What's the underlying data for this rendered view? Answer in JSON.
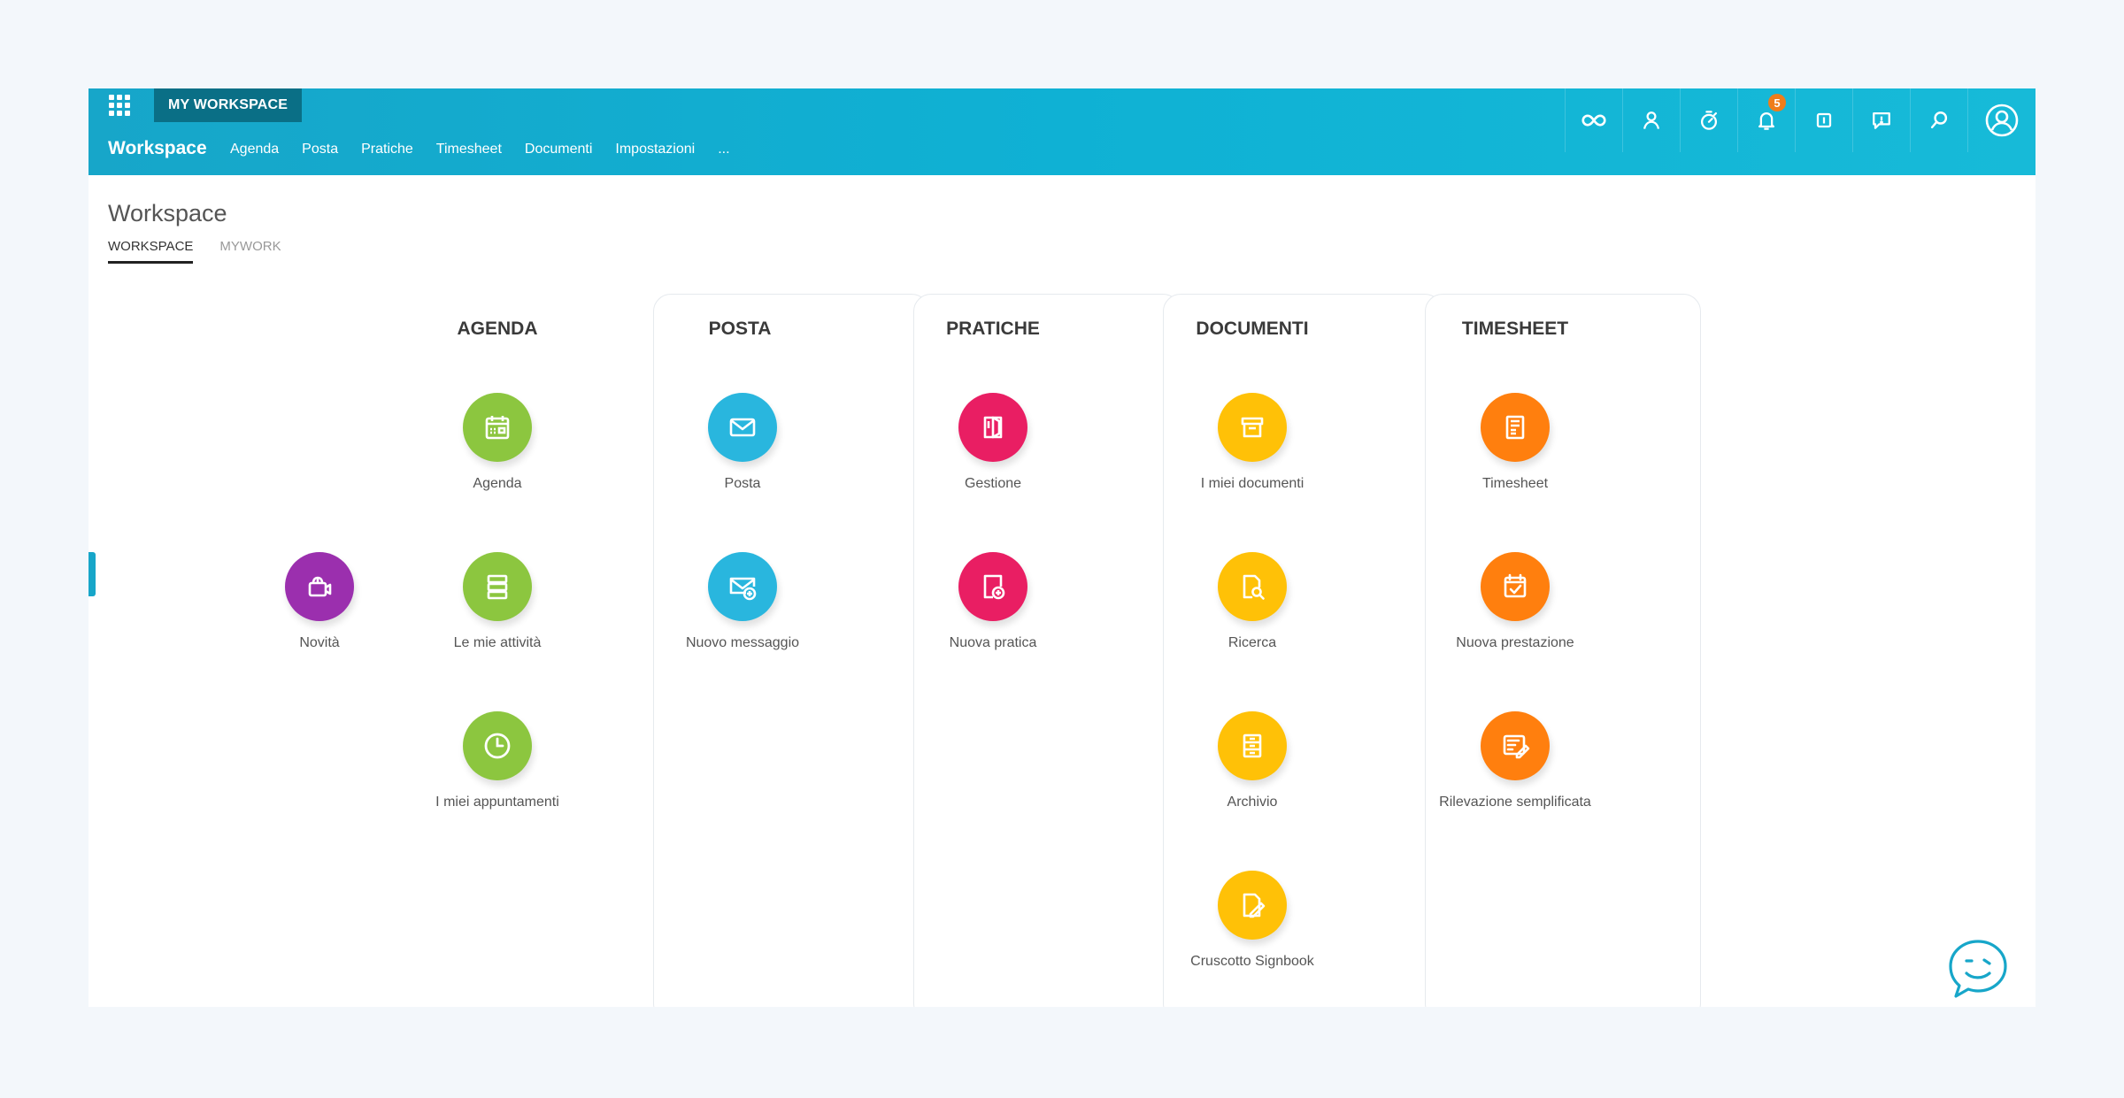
{
  "topbar": {
    "workspace_pill": "MY WORKSPACE",
    "brand": "Workspace",
    "menu": [
      "Agenda",
      "Posta",
      "Pratiche",
      "Timesheet",
      "Documenti",
      "Impostazioni",
      "..."
    ],
    "notifications_count": "5",
    "tools": [
      "infinity-icon",
      "user-icon",
      "timer-icon",
      "bell-icon",
      "calendar-icon",
      "chat-icon",
      "search-icon",
      "account-icon"
    ]
  },
  "page": {
    "title": "Workspace",
    "tabs": [
      "WORKSPACE",
      "MYWORK"
    ]
  },
  "sections": {
    "agenda": {
      "title": "AGENDA",
      "tiles": [
        "Agenda",
        "Novità",
        "Le mie attività",
        "I miei appuntamenti"
      ]
    },
    "posta": {
      "title": "POSTA",
      "tiles": [
        "Posta",
        "Nuovo messaggio"
      ]
    },
    "pratiche": {
      "title": "PRATICHE",
      "tiles": [
        "Gestione",
        "Nuova pratica"
      ]
    },
    "documenti": {
      "title": "DOCUMENTI",
      "tiles": [
        "I miei documenti",
        "Ricerca",
        "Archivio",
        "Cruscotto Signbook"
      ]
    },
    "timesheet": {
      "title": "TIMESHEET",
      "tiles": [
        "Timesheet",
        "Nuova prestazione",
        "Rilevazione semplificata"
      ]
    }
  },
  "colors": {
    "agenda": "#8cc63f",
    "novita": "#9b2fae",
    "posta": "#29b6de",
    "pratiche": "#e91e63",
    "documenti": "#ffc107",
    "timesheet": "#ff7f0e",
    "topbar": "#17a6c9"
  }
}
